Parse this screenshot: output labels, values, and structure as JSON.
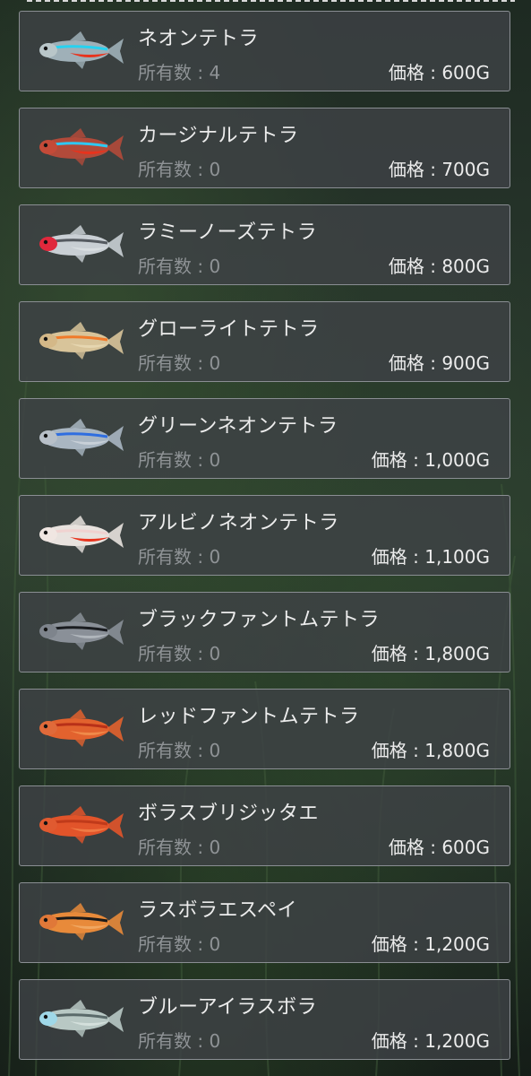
{
  "labels": {
    "owned_prefix": "所有数 : ",
    "price_prefix": "価格 : "
  },
  "fish": [
    {
      "name": "ネオンテトラ",
      "owned": "4",
      "price": "600G",
      "body": "#9fb0b8",
      "stripe": "#27d2f0",
      "belly": "#e8331d",
      "head": "#b9c6c9"
    },
    {
      "name": "カージナルテトラ",
      "owned": "0",
      "price": "700G",
      "body": "#b24a3a",
      "stripe": "#2ec8f2",
      "belly": "#e8331d",
      "head": "#c44a38"
    },
    {
      "name": "ラミーノーズテトラ",
      "owned": "0",
      "price": "800G",
      "body": "#c9cfd4",
      "stripe": "#555a60",
      "belly": "#d8dde0",
      "head": "#e0283c"
    },
    {
      "name": "グローライトテトラ",
      "owned": "0",
      "price": "900G",
      "body": "#d8c49a",
      "stripe": "#f07a2a",
      "belly": "#e6d6b0",
      "head": "#d4b888"
    },
    {
      "name": "グリーンネオンテトラ",
      "owned": "0",
      "price": "1,000G",
      "body": "#a9b6c2",
      "stripe": "#2f6ee0",
      "belly": "#c8d0d8",
      "head": "#b8c0c8"
    },
    {
      "name": "アルビノネオンテトラ",
      "owned": "0",
      "price": "1,100G",
      "body": "#e8e2de",
      "stripe": "#f0d2d0",
      "belly": "#e8331d",
      "head": "#f0e6e2"
    },
    {
      "name": "ブラックファントムテトラ",
      "owned": "0",
      "price": "1,800G",
      "body": "#8a9098",
      "stripe": "#1a1c20",
      "belly": "#b0b6bc",
      "head": "#7e848c"
    },
    {
      "name": "レッドファントムテトラ",
      "owned": "0",
      "price": "1,800G",
      "body": "#e2622e",
      "stripe": "#b83018",
      "belly": "#f08a4a",
      "head": "#e06a3a"
    },
    {
      "name": "ボラスブリジッタエ",
      "owned": "0",
      "price": "600G",
      "body": "#e2542a",
      "stripe": "#c03a1a",
      "belly": "#f07a44",
      "head": "#e05a30"
    },
    {
      "name": "ラスボラエスペイ",
      "owned": "0",
      "price": "1,200G",
      "body": "#e88a3a",
      "stripe": "#1a1a1a",
      "belly": "#f0a660",
      "head": "#e07838"
    },
    {
      "name": "ブルーアイラスボラ",
      "owned": "0",
      "price": "1,200G",
      "body": "#b8c8c4",
      "stripe": "#5a6a6a",
      "belly": "#d4e0dc",
      "head": "#9fd8e8"
    }
  ]
}
